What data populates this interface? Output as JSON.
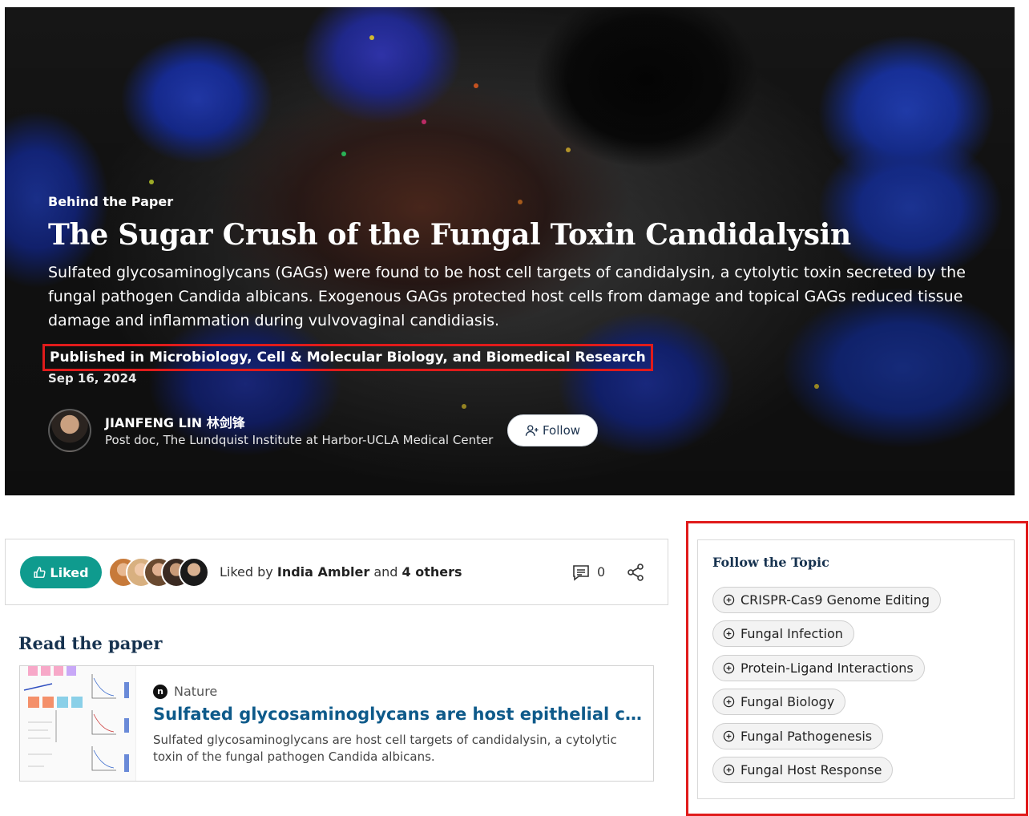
{
  "hero": {
    "kicker": "Behind the Paper",
    "title": "The Sugar Crush of the Fungal Toxin Candidalysin",
    "summary": "Sulfated glycosaminoglycans (GAGs) were found to be host cell targets of candidalysin, a cytolytic toxin secreted by the fungal pathogen Candida albicans. Exogenous GAGs protected host cells from damage and topical GAGs reduced tissue damage and inflammation during vulvovaginal candidiasis.",
    "published": "Published in Microbiology, Cell & Molecular Biology, and Biomedical Research",
    "date": "Sep 16, 2024",
    "author_name": "JIANFENG LIN 林剑锋",
    "author_affiliation": "Post doc, The Lundquist Institute at Harbor-UCLA Medical Center",
    "follow_label": "Follow"
  },
  "likes": {
    "button_label": "Liked",
    "prefix": "Liked by ",
    "person": "India Ambler",
    "middle": " and ",
    "others": "4 others",
    "comment_count": "0"
  },
  "read_paper": {
    "heading": "Read the paper",
    "journal": "Nature",
    "journal_icon_letter": "n",
    "title": "Sulfated glycosaminoglycans are host epithelial cell targets of the Candida albicans toxin candidalysin",
    "description": "Sulfated glycosaminoglycans are host cell targets of candidalysin, a cytolytic toxin of the fungal pathogen Candida albicans."
  },
  "topics": {
    "heading": "Follow the Topic",
    "items": [
      "CRISPR-Cas9 Genome Editing",
      "Fungal Infection",
      "Protein-Ligand Interactions",
      "Fungal Biology",
      "Fungal Pathogenesis",
      "Fungal Host Response"
    ]
  },
  "colors": {
    "accent_teal": "#0f9b8e",
    "heading_navy": "#16324f",
    "link_blue": "#0e5a8a",
    "highlight_red": "#e01b1b"
  }
}
